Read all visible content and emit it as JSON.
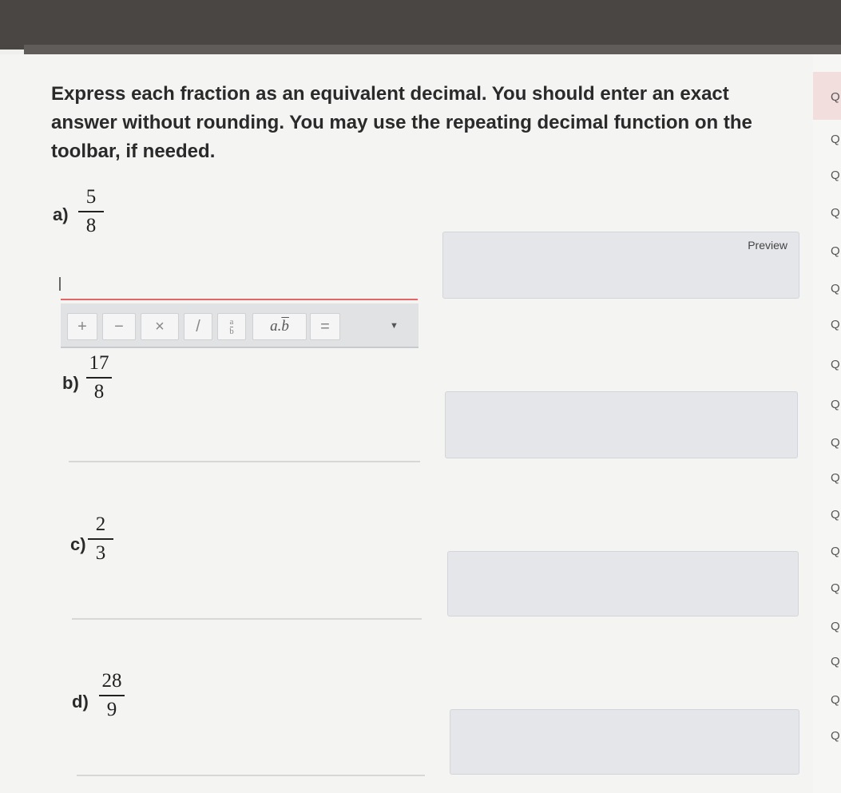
{
  "instructions": "Express each fraction as an equivalent decimal. You should enter an exact answer without rounding. You may use the repeating decimal function on the toolbar, if needed.",
  "questions": [
    {
      "label": "a)",
      "numerator": "5",
      "denominator": "8"
    },
    {
      "label": "b)",
      "numerator": "17",
      "denominator": "8"
    },
    {
      "label": "c)",
      "numerator": "2",
      "denominator": "3"
    },
    {
      "label": "d)",
      "numerator": "28",
      "denominator": "9"
    }
  ],
  "preview": {
    "label": "Preview"
  },
  "toolbar": {
    "plus": "+",
    "minus": "−",
    "times": "×",
    "divide": "/",
    "fraction_numerator": "a",
    "fraction_denominator": "b",
    "repeating_base": "a.",
    "repeating_digit": "b",
    "equals": "=",
    "dropdown": "▼"
  },
  "side_panel": {
    "letter": "Q"
  },
  "colors": {
    "active_underline": "#e26666",
    "preview_bg": "#e5e6ea",
    "toolbar_bg": "#e1e2e4"
  }
}
